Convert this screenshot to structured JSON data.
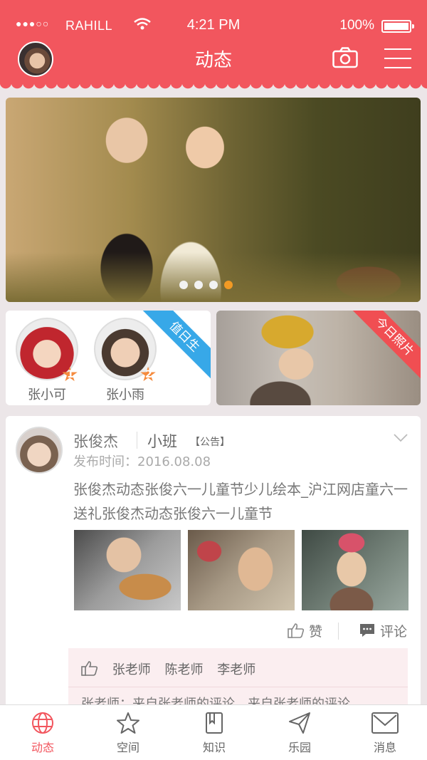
{
  "status_bar": {
    "signal": "●●●○○",
    "carrier": "RAHILL",
    "time": "4:21 PM",
    "battery": "100%"
  },
  "header": {
    "title": "动态",
    "camera_icon": "camera-icon",
    "menu_icon": "menu-icon",
    "accent": "#f2565e"
  },
  "hero": {
    "slide_count": 4,
    "active_slide": 4
  },
  "duty_card": {
    "ribbon": "值日生",
    "kids": [
      {
        "name": "张小可",
        "rank": "1"
      },
      {
        "name": "张小雨",
        "rank": "2"
      }
    ]
  },
  "photo_card": {
    "ribbon": "今日照片"
  },
  "post": {
    "author": "张俊杰",
    "class": "小班",
    "tag": "【公告】",
    "time": "发布时间：2016.08.08",
    "text": "张俊杰动态张俊六一儿童节少儿绘本_沪江网店童六一送礼张俊杰动态张俊六一儿童节",
    "like_label": "赞",
    "comment_label": "评论",
    "likers": [
      "张老师",
      "陈老师",
      "李老师"
    ],
    "comment_preview": "张老师：来自张老师的评论，来自张老师的评论"
  },
  "tabs": [
    {
      "label": "动态",
      "icon": "globe-icon",
      "active": true
    },
    {
      "label": "空间",
      "icon": "star-icon",
      "active": false
    },
    {
      "label": "知识",
      "icon": "book-icon",
      "active": false
    },
    {
      "label": "乐园",
      "icon": "paper-plane-icon",
      "active": false
    },
    {
      "label": "消息",
      "icon": "mail-icon",
      "active": false
    }
  ]
}
